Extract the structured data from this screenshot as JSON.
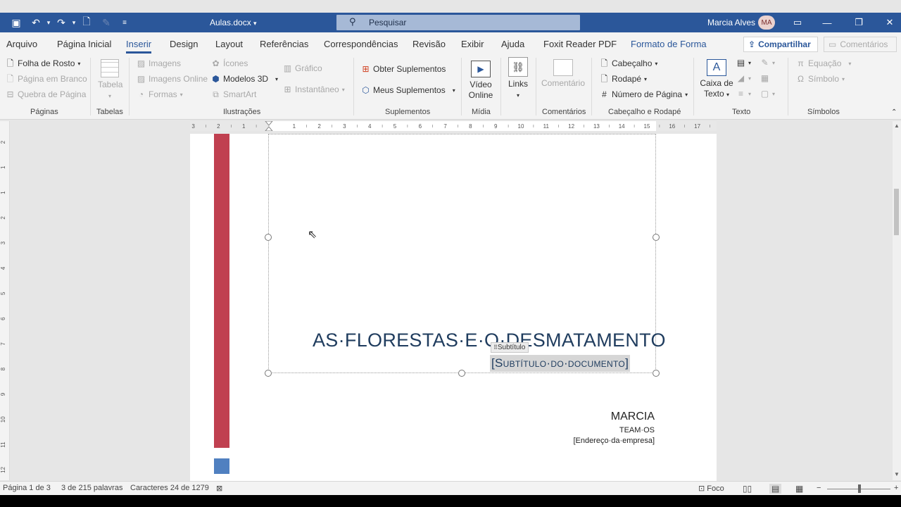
{
  "titlebar": {
    "doc_title": "Aulas.docx",
    "search_placeholder": "Pesquisar",
    "user_name": "Marcia Alves",
    "avatar_initials": "MA"
  },
  "tabs": [
    "Arquivo",
    "Página Inicial",
    "Inserir",
    "Design",
    "Layout",
    "Referências",
    "Correspondências",
    "Revisão",
    "Exibir",
    "Ajuda",
    "Foxit Reader PDF",
    "Formato de Forma"
  ],
  "active_tab": "Inserir",
  "share_label": "Compartilhar",
  "comments_label": "Comentários",
  "ribbon": {
    "paginas": {
      "label": "Páginas",
      "folha": "Folha de Rosto",
      "branco": "Página em Branco",
      "quebra": "Quebra de Página"
    },
    "tabelas": {
      "label": "Tabelas",
      "tabela": "Tabela"
    },
    "ilustracoes": {
      "label": "Ilustrações",
      "imagens": "Imagens",
      "imagens_online": "Imagens Online",
      "formas": "Formas",
      "icones": "Ícones",
      "modelos3d": "Modelos 3D",
      "smartart": "SmartArt",
      "grafico": "Gráfico",
      "instantaneo": "Instantâneo"
    },
    "suplementos": {
      "label": "Suplementos",
      "obter": "Obter Suplementos",
      "meus": "Meus Suplementos"
    },
    "midia": {
      "label": "Mídia",
      "video_line1": "Vídeo",
      "video_line2": "Online"
    },
    "links": {
      "label": "Links"
    },
    "comentarios": {
      "label": "Comentários",
      "comentario": "Comentário"
    },
    "cabecalho": {
      "label": "Cabeçalho e Rodapé",
      "cabecalho": "Cabeçalho",
      "rodape": "Rodapé",
      "numero": "Número de Página"
    },
    "texto": {
      "label": "Texto",
      "caixa_line1": "Caixa de",
      "caixa_line2": "Texto"
    },
    "simbolos": {
      "label": "Símbolos",
      "equacao": "Equação",
      "simbolo": "Símbolo"
    }
  },
  "document": {
    "title": "AS·FLORESTAS·E·O·DESMATAMENTO",
    "subtitle_tag": "Subtítulo",
    "subtitle": "[Subtítulo·do·documento]",
    "author": "MARCIA",
    "company": "TEAM·OS",
    "address": "[Endereço·da·empresa]"
  },
  "ruler_numbers": [
    "3",
    "2",
    "1",
    "1",
    "2",
    "3",
    "4",
    "5",
    "6",
    "7",
    "8",
    "9",
    "10",
    "11",
    "12",
    "13",
    "14",
    "15",
    "16",
    "17"
  ],
  "vruler_numbers": [
    "2",
    "1",
    "1",
    "2",
    "3",
    "4",
    "5",
    "6",
    "7",
    "8",
    "9",
    "10",
    "11",
    "12",
    "13",
    "14"
  ],
  "statusbar": {
    "page": "Página 1 de 3",
    "words": "3 de 215 palavras",
    "chars": "Caracteres 24 de 1279",
    "focus": "Foco"
  },
  "colors": {
    "brand": "#2b579a",
    "accent_bar": "#c04050",
    "accent_square": "#5080c0",
    "title_text": "#1f3c5e"
  }
}
